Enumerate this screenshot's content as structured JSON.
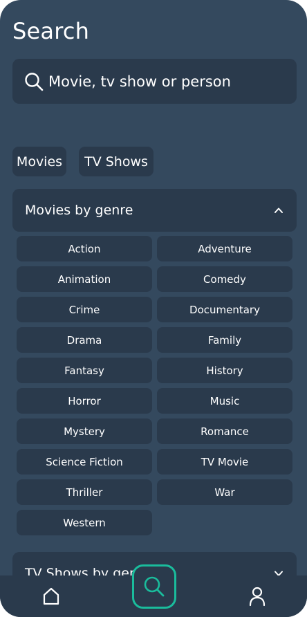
{
  "header": {
    "title": "Search"
  },
  "search": {
    "placeholder": "Movie, tv show or person"
  },
  "filters": [
    {
      "label": "Movies"
    },
    {
      "label": "TV Shows"
    }
  ],
  "movie_genres": {
    "title": "Movies by genre",
    "items": [
      "Action",
      "Adventure",
      "Animation",
      "Comedy",
      "Crime",
      "Documentary",
      "Drama",
      "Family",
      "Fantasy",
      "History",
      "Horror",
      "Music",
      "Mystery",
      "Romance",
      "Science Fiction",
      "TV Movie",
      "Thriller",
      "War",
      "Western"
    ]
  },
  "tv_genres": {
    "title": "TV Shows by genre"
  },
  "nav": {
    "items": [
      "home-icon",
      "search-icon",
      "user-icon"
    ]
  },
  "colors": {
    "background": "#34495e",
    "surface": "#2a3a4c",
    "accent": "#1abc9c",
    "text": "#ffffff"
  }
}
